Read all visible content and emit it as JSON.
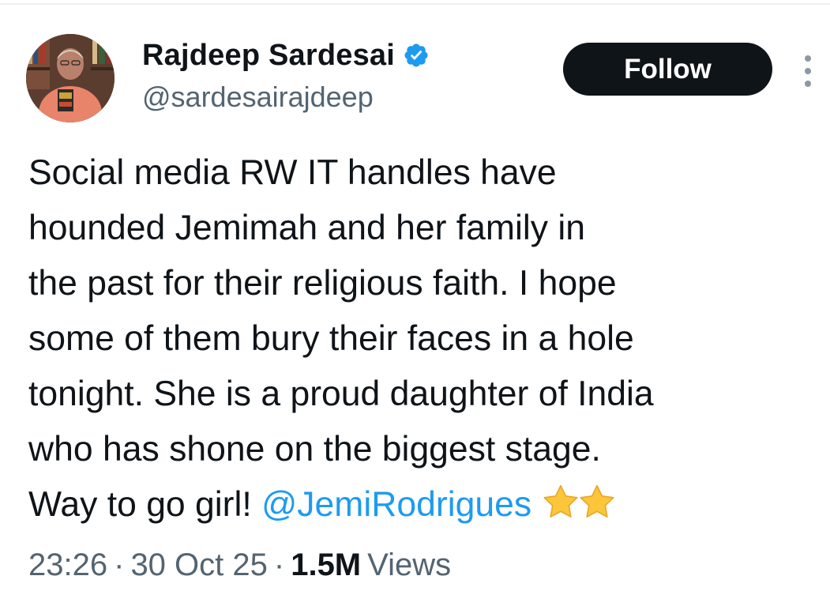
{
  "author": {
    "display_name": "Rajdeep Sardesai",
    "handle": "@sardesairajdeep",
    "verified": true,
    "avatar_icon": "profile-photo"
  },
  "follow_label": "Follow",
  "more_icon": "more-options-icon",
  "tweet": {
    "lines": [
      "Social media RW IT handles have",
      "hounded Jemimah and her family in",
      "the past for their religious faith. I hope",
      "some of them bury their faces in a hole",
      "tonight. She is a proud daughter of India",
      "who has shone on the biggest stage."
    ],
    "last_line_text": "Way to go girl! ",
    "mention": "@JemiRodrigues",
    "emoji": "star-emoji x2"
  },
  "meta": {
    "time": "23:26",
    "separator": "·",
    "date": "30 Oct 25",
    "views_count": "1.5M",
    "views_label": "Views"
  },
  "colors": {
    "text": "#0f1419",
    "secondary": "#536471",
    "link": "#1d9bf0",
    "verified": "#1d9bf0",
    "follow_bg": "#0f1419",
    "follow_text": "#ffffff"
  }
}
